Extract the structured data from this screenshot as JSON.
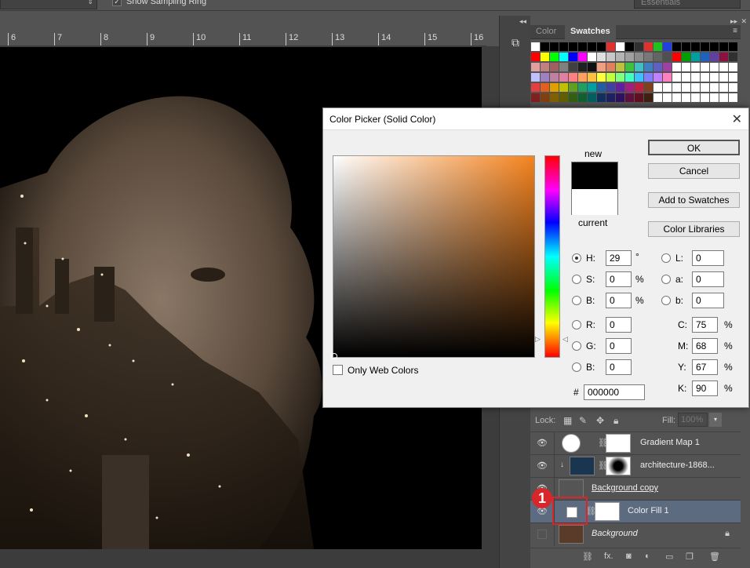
{
  "options_bar": {
    "dropdown_arrow": "⇕",
    "sampling_ring_checked": "✓",
    "sampling_ring_label": "Show Sampling Ring",
    "workspace": "Essentials"
  },
  "ruler": {
    "ticks": [
      "6",
      "7",
      "8",
      "9",
      "10",
      "11",
      "12",
      "13",
      "14",
      "15",
      "16"
    ]
  },
  "right_panel": {
    "tabs": [
      "Color",
      "Swatches"
    ],
    "active_tab": "Swatches",
    "swatch_colors": [
      "#ffffff",
      "#000000",
      "#000000",
      "#000000",
      "#000000",
      "#000000",
      "#000000",
      "#000000",
      "#e03030",
      "#ffffff",
      "#000000",
      "#303030",
      "#e03030",
      "#20c020",
      "#2040e0",
      "#000000",
      "#000000",
      "#000000",
      "#000000",
      "#000000",
      "#000000",
      "#000000",
      "#ff0000",
      "#ffff00",
      "#00ff00",
      "#00ffff",
      "#0000ff",
      "#ff00ff",
      "#ffffff",
      "#e0e0e0",
      "#c8c8c8",
      "#b4b4b4",
      "#a0a0a0",
      "#8c8c8c",
      "#787878",
      "#646464",
      "#505050",
      "#ff0000",
      "#00a000",
      "#00a0a0",
      "#2060c0",
      "#6040a0",
      "#8c1040",
      "#303030",
      "#e0a0a0",
      "#c08080",
      "#a06060",
      "#808080",
      "#404040",
      "#202020",
      "#101010",
      "#f0a080",
      "#e08060",
      "#c0c040",
      "#40c040",
      "#40c0c0",
      "#4080c0",
      "#6060c0",
      "#a040a0",
      "#ffffff",
      "#ffffff",
      "#ffffff",
      "#ffffff",
      "#ffffff",
      "#ffffff",
      "#ffffff",
      "#c0c0ff",
      "#a080c0",
      "#c080a0",
      "#e080a0",
      "#ff8080",
      "#ffa060",
      "#ffc040",
      "#ffff40",
      "#c0ff40",
      "#80ff80",
      "#40ffc0",
      "#40c0ff",
      "#8080ff",
      "#c080ff",
      "#ff80c0",
      "#ffffff",
      "#ffffff",
      "#ffffff",
      "#ffffff",
      "#ffffff",
      "#ffffff",
      "#ffffff",
      "#e04040",
      "#e06020",
      "#e0a000",
      "#c0c000",
      "#60a020",
      "#20a060",
      "#00a0a0",
      "#2060a0",
      "#4040a0",
      "#6020a0",
      "#a02080",
      "#c02040",
      "#804020",
      "#ffffff",
      "#ffffff",
      "#ffffff",
      "#ffffff",
      "#ffffff",
      "#ffffff",
      "#ffffff",
      "#ffffff",
      "#ffffff",
      "#802020",
      "#804010",
      "#806000",
      "#606000",
      "#306010",
      "#106030",
      "#006060",
      "#103060",
      "#202060",
      "#301060",
      "#601040",
      "#601020",
      "#402010",
      "#ffffff",
      "#ffffff",
      "#ffffff",
      "#ffffff",
      "#ffffff",
      "#ffffff",
      "#ffffff",
      "#ffffff",
      "#ffffff"
    ]
  },
  "color_picker": {
    "title": "Color Picker (Solid Color)",
    "close_glyph": "✕",
    "new_label": "new",
    "current_label": "current",
    "new_color": "#000000",
    "current_color": "#ffffff",
    "buttons": {
      "ok": "OK",
      "cancel": "Cancel",
      "add_to_swatches": "Add to Swatches",
      "color_libraries": "Color Libraries"
    },
    "hsb": {
      "h_label": "H:",
      "h": "29",
      "h_unit": "°",
      "s_label": "S:",
      "s": "0",
      "s_unit": "%",
      "b_label": "B:",
      "b": "0",
      "b_unit": "%"
    },
    "rgb": {
      "r_label": "R:",
      "r": "0",
      "g_label": "G:",
      "g": "0",
      "b_label": "B:",
      "b": "0"
    },
    "lab": {
      "l_label": "L:",
      "l": "0",
      "a_label": "a:",
      "a": "0",
      "b_label": "b:",
      "b": "0"
    },
    "cmyk": {
      "c_label": "C:",
      "c": "75",
      "m_label": "M:",
      "m": "68",
      "y_label": "Y:",
      "y": "67",
      "k_label": "K:",
      "k": "90",
      "unit": "%"
    },
    "hex_label": "#",
    "hex": "000000",
    "only_web_colors": "Only Web Colors"
  },
  "layers_panel": {
    "lock_label": "Lock:",
    "fill_label": "Fill:",
    "fill_value": "100%",
    "fill_arrow": "▾",
    "layers": [
      {
        "name": "Gradient Map 1",
        "visible": true
      },
      {
        "name": "architecture-1868...",
        "visible": true
      },
      {
        "name": "Background copy",
        "visible": true
      },
      {
        "name": "Color Fill 1",
        "visible": true,
        "selected": true
      },
      {
        "name": "Background",
        "visible": false,
        "locked": true
      }
    ]
  },
  "annotation": {
    "number": "1"
  }
}
